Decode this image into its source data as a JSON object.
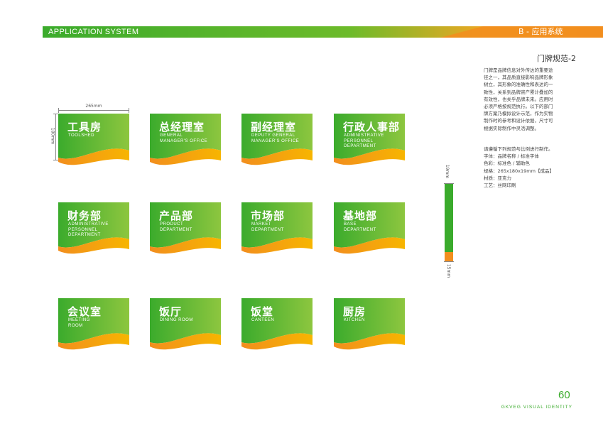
{
  "header": {
    "left_title": "APPLICATION SYSTEM",
    "right_title": "B - 应用系统"
  },
  "page_subtitle": "门牌规范-2",
  "description_lines": [
    "门牌是品牌信息对外传达的重要途",
    "径之一，其品质直接影响品牌形象",
    "树立，其形象的准确性和表达的一",
    "致性，关系到品牌资产累计叠加的",
    "有效性，也关乎品牌未来。应用时",
    "必须严格按规范执行。以下的部门",
    "牌方案乃模拟设计示范，作为实物",
    "制作时的参考和设计依据，尺寸可",
    "根据实际制作中灵活调整。"
  ],
  "spec_lines": [
    "请遵循下列规范与比例进行制作。",
    "字体：品牌名称 / 标准字体",
    "色彩：标准色 / 辅助色",
    "规格：265x180x19mm【成品】",
    "材质：亚克力",
    "工艺：丝网印刷"
  ],
  "dimensions": {
    "width": "265mm",
    "height": "180mm",
    "thickness": "19mm",
    "base": "15mm"
  },
  "colors": {
    "green": "#3bab2c",
    "light_green": "#8dc63f",
    "orange": "#f28e1e",
    "yellow": "#f7b500"
  },
  "signs": [
    {
      "title": "工具房",
      "english": "TOOLSHED"
    },
    {
      "title": "总经理室",
      "english": "GENERAL\nMANAGER'S OFFICE"
    },
    {
      "title": "副经理室",
      "english": "DEPUTY GENERAL\nMANAGER'S OFFICE"
    },
    {
      "title": "行政人事部",
      "english": "ADMINISTRATIVE\nPERSONNEL DEPARTMENT"
    },
    {
      "title": "财务部",
      "english": "ADMINISTRATIVE\nPERSONNEL DEPARTMENT"
    },
    {
      "title": "产品部",
      "english": "PRODUCT\nDEPARTMENT"
    },
    {
      "title": "市场部",
      "english": "MARKET\nDEPARTMENT"
    },
    {
      "title": "基地部",
      "english": "BASE\nDEPARTMENT"
    },
    {
      "title": "会议室",
      "english": "MEETING\nROOM"
    },
    {
      "title": "饭厅",
      "english": "DINING ROOM"
    },
    {
      "title": "饭堂",
      "english": "CANTEEN"
    },
    {
      "title": "厨房",
      "english": "KITCHEN"
    }
  ],
  "footer": {
    "page_number": "60",
    "brand": "GKVEG VISUAL IDENTITY"
  }
}
